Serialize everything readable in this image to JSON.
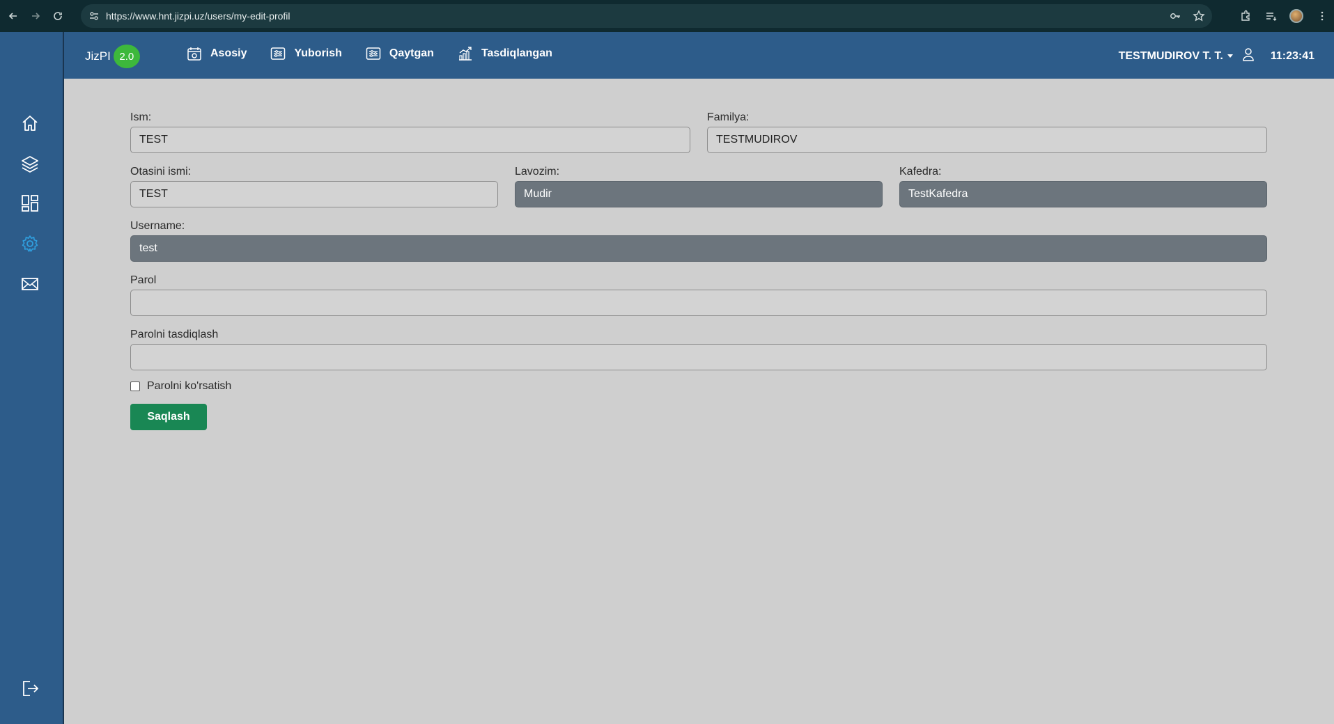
{
  "browser": {
    "url": "https://www.hnt.jizpi.uz/users/my-edit-profil"
  },
  "brand": {
    "name": "JizPI",
    "version": "2.0"
  },
  "topnav": [
    {
      "label": "Asosiy",
      "icon": "calendar-icon"
    },
    {
      "label": "Yuborish",
      "icon": "sliders-icon"
    },
    {
      "label": "Qaytgan",
      "icon": "sliders-icon"
    },
    {
      "label": "Tasdiqlangan",
      "icon": "bar-chart-icon"
    }
  ],
  "user": {
    "name": "TESTMUDIROV T. T.",
    "time": "11:23:41"
  },
  "sidebar": {
    "items": [
      "home-icon",
      "layers-icon",
      "dashboard-icon",
      "gear-icon",
      "mail-icon",
      "logout-icon"
    ]
  },
  "form": {
    "first_name": {
      "label": "Ism:",
      "value": "TEST"
    },
    "last_name": {
      "label": "Familya:",
      "value": "TESTMUDIROV"
    },
    "patronymic": {
      "label": "Otasini ismi:",
      "value": "TEST"
    },
    "position": {
      "label": "Lavozim:",
      "value": "Mudir"
    },
    "department": {
      "label": "Kafedra:",
      "value": "TestKafedra"
    },
    "username": {
      "label": "Username:",
      "value": "test"
    },
    "password": {
      "label": "Parol",
      "value": ""
    },
    "password_confirm": {
      "label": "Parolni tasdiqlash",
      "value": ""
    },
    "show_password_label": "Parolni ko'rsatish",
    "save_label": "Saqlash"
  },
  "colors": {
    "header": "#2d5c8a",
    "page_bg": "#cfcfcf",
    "disabled_input": "#6c757d",
    "save_button": "#198754",
    "version_badge": "#3db83b"
  }
}
